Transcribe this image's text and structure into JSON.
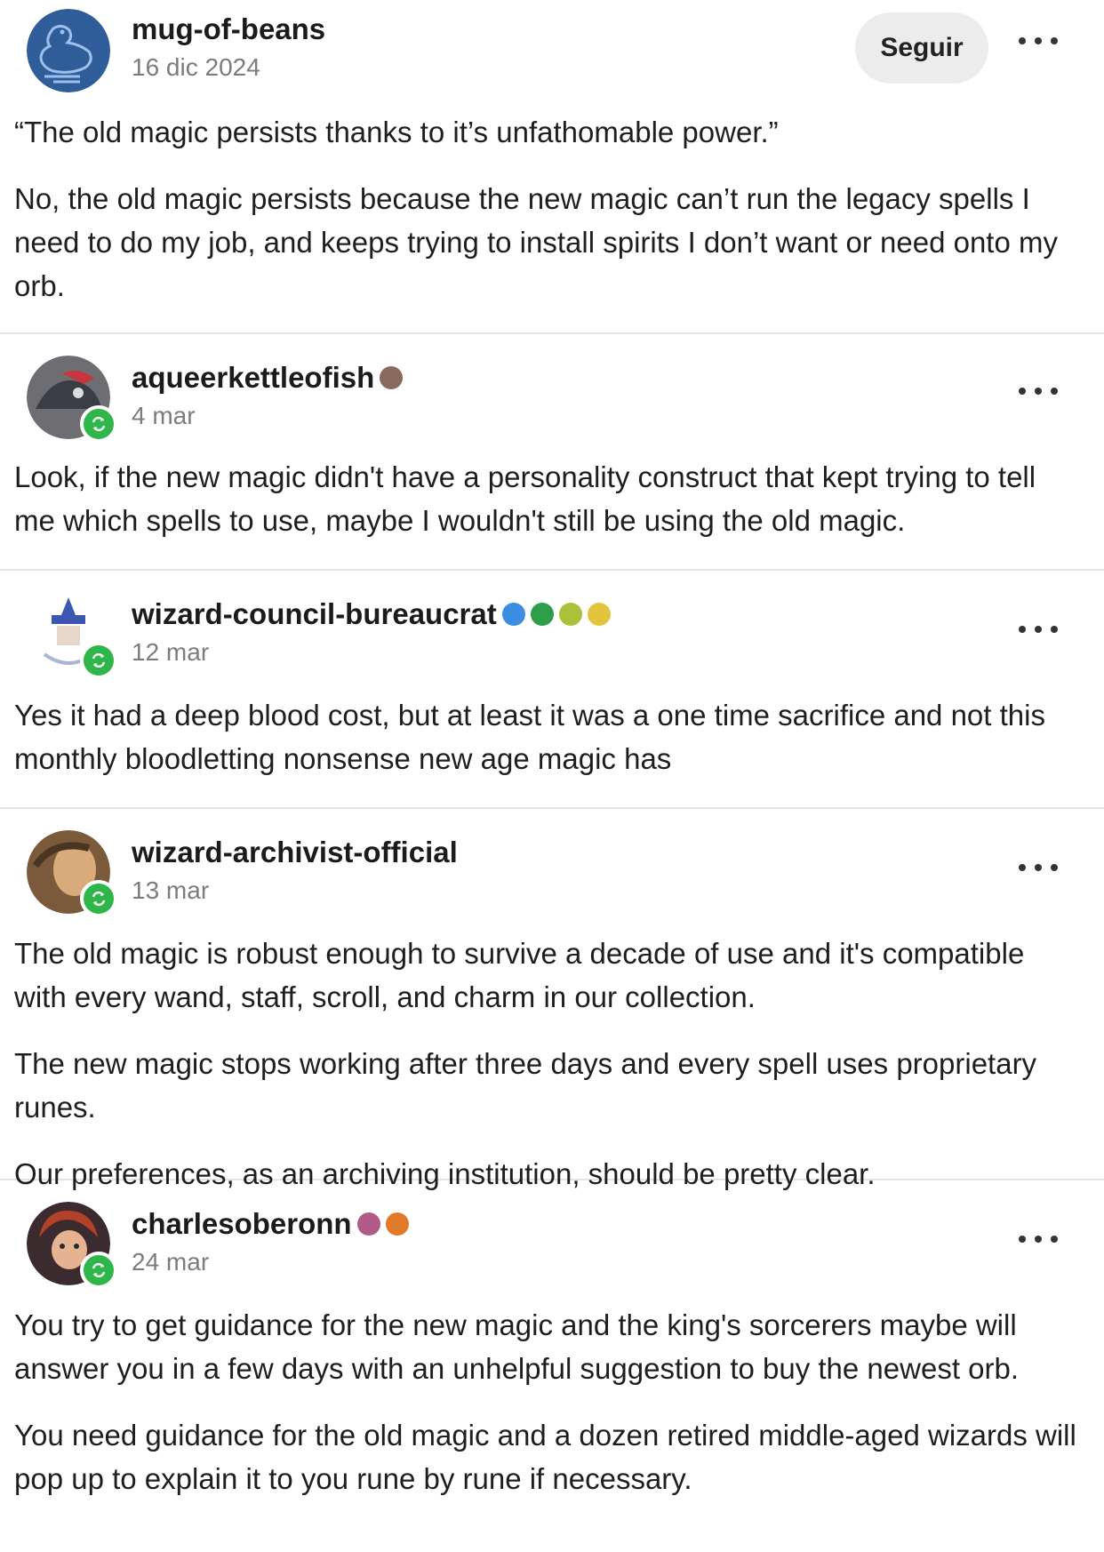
{
  "posts": [
    {
      "username": "mug-of-beans",
      "date": "16 dic 2024",
      "follow_label": "Seguir",
      "paragraphs": [
        "“The old magic persists thanks to it’s unfathomable power.”",
        "No, the old magic persists because the new magic can’t run the legacy spells I need to do my job, and keeps trying to install spirits I don’t want or need onto my orb."
      ]
    },
    {
      "username": "aqueerkettleofish",
      "date": "4 mar",
      "paragraphs": [
        "Look, if the new magic didn't have a personality construct that kept trying to tell me which spells to use, maybe I wouldn't still be using the old magic."
      ]
    },
    {
      "username": "wizard-council-bureaucrat",
      "date": "12 mar",
      "paragraphs": [
        "Yes it had a deep blood cost, but at least it was a one time sacrifice and not this monthly bloodletting nonsense new age magic has"
      ]
    },
    {
      "username": "wizard-archivist-official",
      "date": "13 mar",
      "paragraphs": [
        "The old magic is robust enough to survive a decade of use and it's compatible with every wand, staff, scroll, and charm in our collection.",
        "The new magic stops working after three days and every spell uses proprietary runes.",
        "Our preferences, as an archiving institution, should be pretty clear."
      ]
    },
    {
      "username": "charlesoberonn",
      "date": "24 mar",
      "paragraphs": [
        "You try to get guidance for the new magic and the king's sorcerers maybe will answer you in a few days with an unhelpful suggestion to buy the newest orb.",
        "You need guidance for the old magic and a dozen retired middle-aged wizards will pop up to explain it to you rune by rune if necessary."
      ]
    }
  ],
  "colors": {
    "reblog_badge": "#2fb64a",
    "verified_blue": "#3a8de0",
    "verified_green": "#2f9e4a",
    "verified_yellow": "#e2c53a",
    "divider": "#e3e3e3",
    "date_gray": "#7c7c7c"
  },
  "icons": {
    "more": "more-options-icon",
    "reblog": "reblog-icon"
  }
}
